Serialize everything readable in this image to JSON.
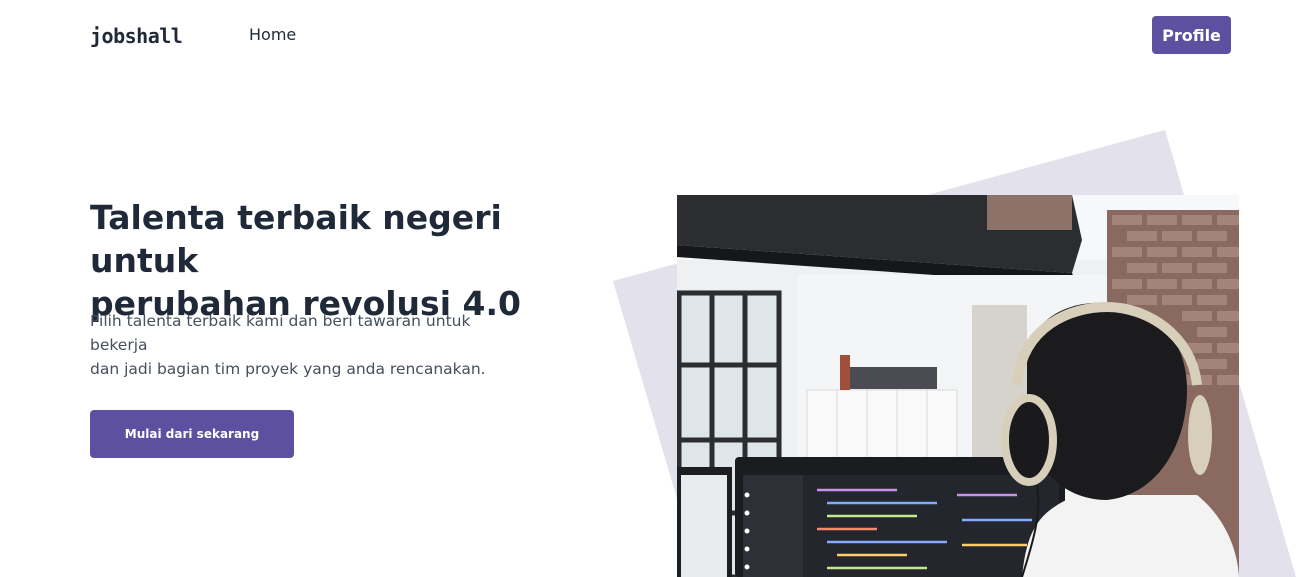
{
  "navbar": {
    "logo_text": "jobshall",
    "home_label": "Home",
    "profile_label": "Profile"
  },
  "hero": {
    "title_line1": "Talenta terbaik negeri untuk",
    "title_line2": "perubahan revolusi 4.0",
    "description_line1": "Pilih talenta terbaik kami dan beri tawaran untuk bekerja",
    "description_line2": "dan jadi bagian tim proyek yang anda rencanakan.",
    "cta_label": "Mulai dari sekarang"
  },
  "colors": {
    "accent": "#5e50a1",
    "shape": "#e2e1ec",
    "text_dark": "#1f2937",
    "text_muted": "#46505c"
  }
}
